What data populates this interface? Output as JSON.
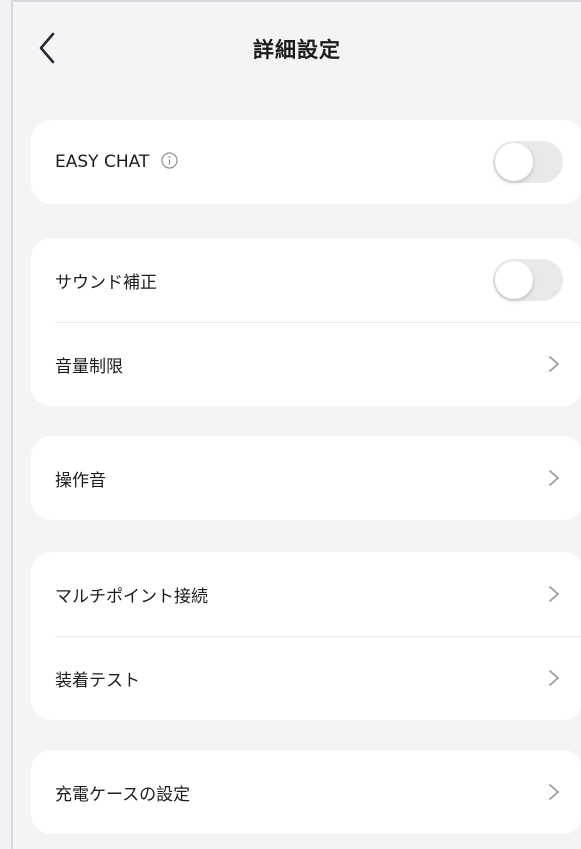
{
  "header": {
    "title": "詳細設定",
    "back_icon": "chevron-left-icon"
  },
  "sections": [
    {
      "rows": [
        {
          "label": "EASY CHAT",
          "info_icon": "info-circle-icon",
          "control": "toggle",
          "on": false
        }
      ]
    },
    {
      "rows": [
        {
          "label": "サウンド補正",
          "control": "toggle",
          "on": false
        },
        {
          "label": "音量制限",
          "control": "chevron"
        }
      ]
    },
    {
      "rows": [
        {
          "label": "操作音",
          "control": "chevron"
        }
      ]
    },
    {
      "rows": [
        {
          "label": "マルチポイント接続",
          "control": "chevron"
        },
        {
          "label": "装着テスト",
          "control": "chevron"
        }
      ]
    },
    {
      "rows": [
        {
          "label": "充電ケースの設定",
          "control": "chevron"
        }
      ]
    }
  ],
  "colors": {
    "background": "#f4f4f6",
    "card": "#ffffff",
    "toggle_off": "#e9e9eb",
    "chevron": "#9a9aa0"
  }
}
